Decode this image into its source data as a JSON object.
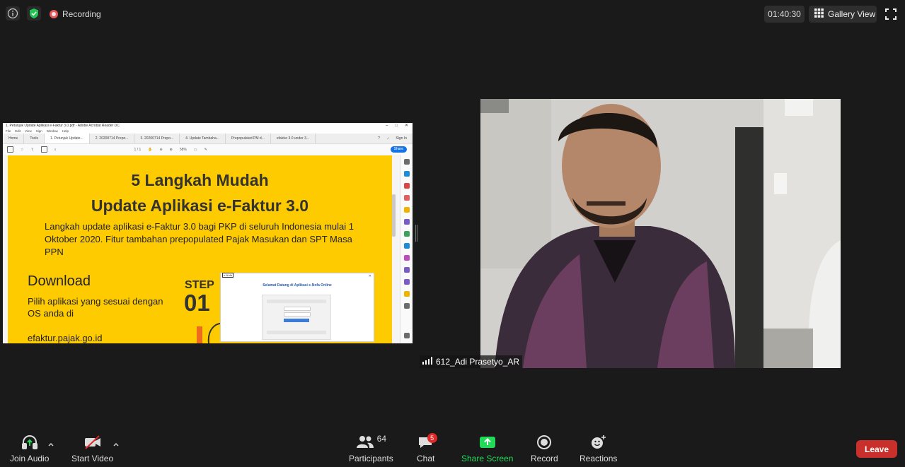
{
  "top_bar": {
    "recording_label": "Recording",
    "timer": "01:40:30",
    "view_label": "Gallery View"
  },
  "shared_screen": {
    "window_title": "1. Petunjuk Update Aplikasi e-Faktur 3.0.pdf - Adobe Acrobat Reader DC",
    "menu": [
      "File",
      "Edit",
      "View",
      "Sign",
      "Window",
      "Help"
    ],
    "tabs": [
      "Home",
      "Tools",
      "1. Petunjuk Update...",
      "2. 20200714 Prepo...",
      "3. 20200714 Prepo...",
      "4. Update Tambaha...",
      "Prepopulated PM d...",
      "efaktur 3.0 under 3..."
    ],
    "sign_in": "Sign In",
    "page_indicator": "1 / 1",
    "zoom": "58%",
    "share_btn": "Share",
    "heading_line1": "5 Langkah Mudah",
    "heading_line2": "Update Aplikasi e-Faktur 3.0",
    "lead_text": "Langkah update aplikasi e-Faktur 3.0 bagi PKP di seluruh Indonesia mulai 1 Oktober 2020. Fitur tambahan prepopulated Pajak Masukan dan SPT Masa PPN",
    "download_title": "Download",
    "download_text": "Pilih aplikasi yang sesuai dengan OS anda di",
    "download_url": "efaktur.pajak.go.id",
    "step_label": "STEP",
    "step_number": "01",
    "screenshot_title": "Selamat Datang di Aplikasi e-Nofa Online"
  },
  "participant": {
    "name": "612_Adi Prasetyo_AR"
  },
  "toolbar": {
    "join_audio": "Join Audio",
    "start_video": "Start Video",
    "participants": "Participants",
    "participants_count": "64",
    "chat": "Chat",
    "chat_badge": "5",
    "share_screen": "Share Screen",
    "record": "Record",
    "reactions": "Reactions",
    "leave": "Leave"
  },
  "colors": {
    "background": "#1a1a1a",
    "share_green": "#23d959",
    "leave_red": "#c9302c",
    "badge_red": "#e02828",
    "pdf_yellow": "#fecb00",
    "recording_dot": "#e25a5a"
  },
  "icons": [
    "info-icon",
    "shield-check-icon",
    "record-dot-icon",
    "grid-icon",
    "fullscreen-icon",
    "headphones-icon",
    "video-off-icon",
    "chevron-up-icon",
    "participants-icon",
    "chat-icon",
    "share-screen-icon",
    "record-icon",
    "reactions-icon",
    "signal-bars-icon"
  ]
}
